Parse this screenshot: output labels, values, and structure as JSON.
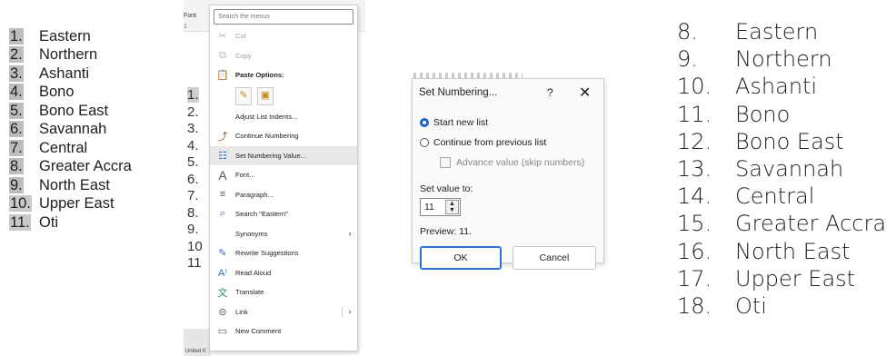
{
  "left_list": {
    "items": [
      {
        "num": "1.",
        "label": "Eastern"
      },
      {
        "num": "2.",
        "label": "Northern"
      },
      {
        "num": "3.",
        "label": "Ashanti"
      },
      {
        "num": "4.",
        "label": "Bono"
      },
      {
        "num": "5.",
        "label": "Bono East"
      },
      {
        "num": "6.",
        "label": "Savannah"
      },
      {
        "num": "7.",
        "label": "Central"
      },
      {
        "num": "8.",
        "label": "Greater Accra"
      },
      {
        "num": "9.",
        "label": "North East"
      },
      {
        "num": "10.",
        "label": "Upper East"
      },
      {
        "num": "11.",
        "label": "Oti"
      }
    ]
  },
  "word_bg": {
    "font_label": "Font",
    "ruler": "1",
    "nums": [
      "1.",
      "2.",
      "3.",
      "4.",
      "5.",
      "6.",
      "7.",
      "8.",
      "9.",
      "10",
      "11"
    ],
    "status": "United K"
  },
  "context_menu": {
    "search_placeholder": "Search the menus",
    "cut": "Cut",
    "copy": "Copy",
    "paste_options": "Paste Options:",
    "adjust_list_indents": "Adjust List Indents...",
    "continue_numbering": "Continue Numbering",
    "set_numbering_value": "Set Numbering Value...",
    "font": "Font...",
    "paragraph": "Paragraph...",
    "search": "Search \"Eastern\"",
    "synonyms": "Synonyms",
    "rewrite": "Rewrite Suggestions",
    "read_aloud": "Read Aloud",
    "translate": "Translate",
    "link": "Link",
    "new_comment": "New Comment"
  },
  "dialog": {
    "title": "Set Numbering...",
    "help": "?",
    "close": "✕",
    "start_new_list": "Start new list",
    "continue_previous": "Continue from previous list",
    "advance_value": "Advance value (skip numbers)",
    "set_value_label": "Set value to:",
    "value": "11",
    "preview": "Preview: 11.",
    "ok": "OK",
    "cancel": "Cancel"
  },
  "right_list": {
    "items": [
      {
        "num": "8.",
        "label": "Eastern"
      },
      {
        "num": "9.",
        "label": "Northern"
      },
      {
        "num": "10.",
        "label": "Ashanti"
      },
      {
        "num": "11.",
        "label": "Bono"
      },
      {
        "num": "12.",
        "label": "Bono East"
      },
      {
        "num": "13.",
        "label": "Savannah"
      },
      {
        "num": "14.",
        "label": "Central"
      },
      {
        "num": "15.",
        "label": "Greater Accra"
      },
      {
        "num": "16.",
        "label": "North East"
      },
      {
        "num": "17.",
        "label": "Upper East"
      },
      {
        "num": "18.",
        "label": "Oti"
      }
    ]
  },
  "colors": {
    "accent": "#1a64c8",
    "highlight": "#bdbdbd"
  }
}
